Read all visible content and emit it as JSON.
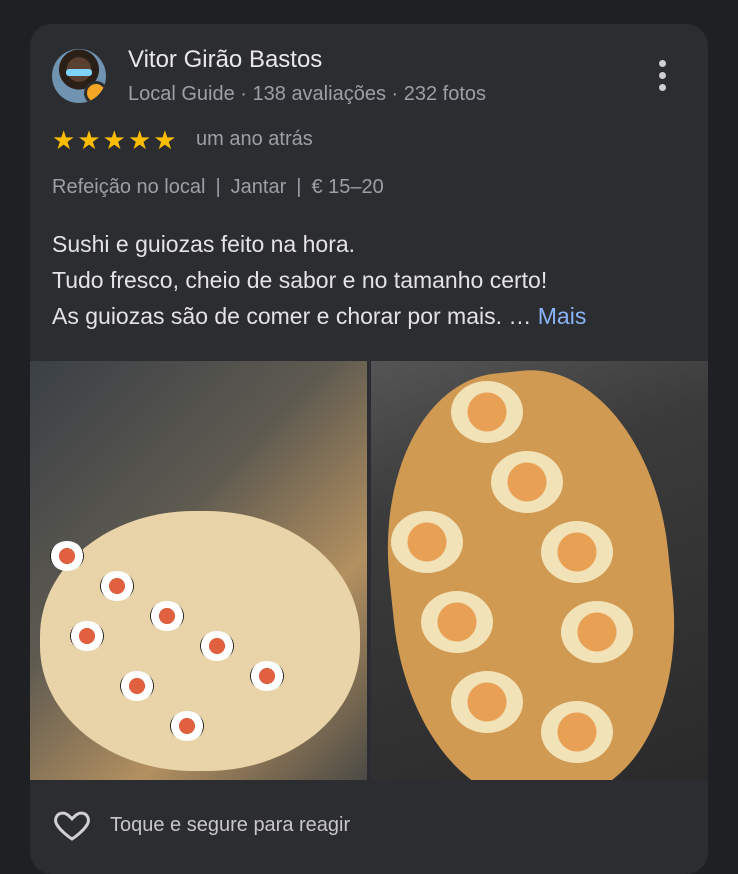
{
  "reviewer": {
    "name": "Vitor Girão Bastos",
    "meta": "Local Guide · 138 avaliações · 232 fotos"
  },
  "menu": {
    "icon": "more-vert-icon"
  },
  "rating": {
    "stars": 5,
    "max": 5,
    "time": "um ano atrás"
  },
  "tags": {
    "t1": "Refeição no local",
    "t2": "Jantar",
    "t3": "€ 15–20",
    "separator": "|"
  },
  "review": {
    "line1": "Sushi e guiozas feito na hora.",
    "line2": "Tudo fresco, cheio de sabor e no tamanho certo!",
    "line3": "As guiozas são de comer e chorar por mais. …",
    "more": "Mais"
  },
  "photos": [
    {
      "icon": "sushi-platter-photo"
    },
    {
      "icon": "stuffed-rolls-photo"
    }
  ],
  "footer": {
    "icon": "heart-outline-icon",
    "label": "Toque e segure para reagir"
  },
  "colors": {
    "background": "#1f2023",
    "card": "#2c2d31",
    "star": "#fbbc04",
    "link": "#8ab4f8",
    "muted": "#9aa0a6"
  }
}
